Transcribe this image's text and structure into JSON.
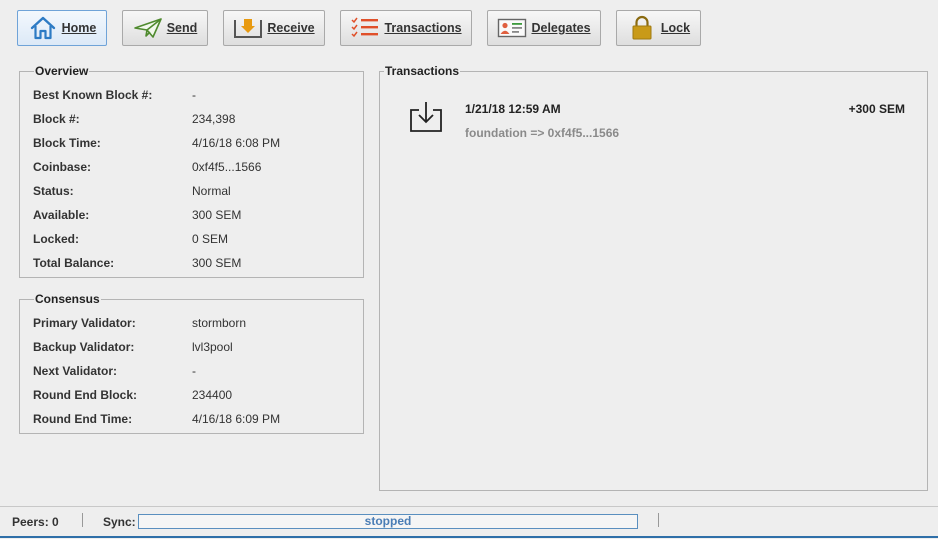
{
  "toolbar": {
    "buttons": [
      {
        "label": "Home",
        "icon": "home-icon",
        "selected": true
      },
      {
        "label": "Send",
        "icon": "paper-plane-icon",
        "selected": false
      },
      {
        "label": "Receive",
        "icon": "receive-tray-icon",
        "selected": false
      },
      {
        "label": "Transactions",
        "icon": "checklist-icon",
        "selected": false
      },
      {
        "label": "Delegates",
        "icon": "id-card-icon",
        "selected": false
      },
      {
        "label": "Lock",
        "icon": "padlock-icon",
        "selected": false
      }
    ]
  },
  "overview": {
    "title": "Overview",
    "rows": [
      {
        "label": "Best Known Block #:",
        "value": "-"
      },
      {
        "label": "Block #:",
        "value": "234,398"
      },
      {
        "label": "Block Time:",
        "value": "4/16/18 6:08 PM"
      },
      {
        "label": "Coinbase:",
        "value": "0xf4f5...1566"
      },
      {
        "label": "Status:",
        "value": "Normal"
      },
      {
        "label": "Available:",
        "value": "300 SEM"
      },
      {
        "label": "Locked:",
        "value": "0 SEM"
      },
      {
        "label": "Total Balance:",
        "value": "300 SEM"
      }
    ]
  },
  "consensus": {
    "title": "Consensus",
    "rows": [
      {
        "label": "Primary Validator:",
        "value": "stormborn"
      },
      {
        "label": "Backup Validator:",
        "value": "lvl3pool"
      },
      {
        "label": "Next Validator:",
        "value": "-"
      },
      {
        "label": "Round End Block:",
        "value": "234400"
      },
      {
        "label": "Round End Time:",
        "value": "4/16/18 6:09 PM"
      }
    ]
  },
  "transactions": {
    "title": "Transactions",
    "items": [
      {
        "icon": "inbox-download-icon",
        "date": "1/21/18 12:59 AM",
        "amount": "+300 SEM",
        "description": "foundation => 0xf4f5...1566"
      }
    ]
  },
  "status_bar": {
    "peers_label": "Peers: 0",
    "sync_label": "Sync:",
    "sync_status": "stopped",
    "sync_progress": 0
  },
  "colors": {
    "accent": "#2f6fa8",
    "selected_border": "#6fa3d8",
    "progress_border": "#5a8fbf",
    "send_icon": "#4f8a2e",
    "receive_icon": "#d88a10",
    "transactions_icon": "#e0502a",
    "lock_icon": "#c99a18"
  }
}
